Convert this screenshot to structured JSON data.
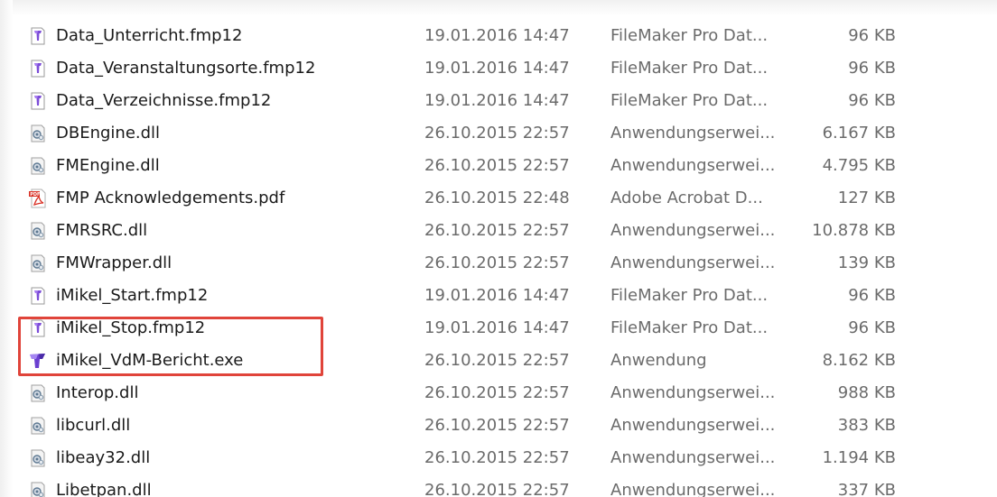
{
  "highlight_color": "#e0443a",
  "files": [
    {
      "icon": "filemaker-file-icon",
      "name": "Data_Unterricht.fmp12",
      "date": "19.01.2016 14:47",
      "type": "FileMaker Pro Dat...",
      "size": "96 KB"
    },
    {
      "icon": "filemaker-file-icon",
      "name": "Data_Veranstaltungsorte.fmp12",
      "date": "19.01.2016 14:47",
      "type": "FileMaker Pro Dat...",
      "size": "96 KB"
    },
    {
      "icon": "filemaker-file-icon",
      "name": "Data_Verzeichnisse.fmp12",
      "date": "19.01.2016 14:47",
      "type": "FileMaker Pro Dat...",
      "size": "96 KB"
    },
    {
      "icon": "dll-file-icon",
      "name": "DBEngine.dll",
      "date": "26.10.2015 22:57",
      "type": "Anwendungserwei...",
      "size": "6.167 KB"
    },
    {
      "icon": "dll-file-icon",
      "name": "FMEngine.dll",
      "date": "26.10.2015 22:57",
      "type": "Anwendungserwei...",
      "size": "4.795 KB"
    },
    {
      "icon": "pdf-file-icon",
      "name": "FMP Acknowledgements.pdf",
      "date": "26.10.2015 22:48",
      "type": "Adobe Acrobat D...",
      "size": "127 KB"
    },
    {
      "icon": "dll-file-icon",
      "name": "FMRSRC.dll",
      "date": "26.10.2015 22:57",
      "type": "Anwendungserwei...",
      "size": "10.878 KB"
    },
    {
      "icon": "dll-file-icon",
      "name": "FMWrapper.dll",
      "date": "26.10.2015 22:57",
      "type": "Anwendungserwei...",
      "size": "139 KB"
    },
    {
      "icon": "filemaker-file-icon",
      "name": "iMikel_Start.fmp12",
      "date": "19.01.2016 14:47",
      "type": "FileMaker Pro Dat...",
      "size": "96 KB"
    },
    {
      "icon": "filemaker-file-icon",
      "name": "iMikel_Stop.fmp12",
      "date": "19.01.2016 14:47",
      "type": "FileMaker Pro Dat...",
      "size": "96 KB"
    },
    {
      "icon": "filemaker-app-icon",
      "name": "iMikel_VdM-Bericht.exe",
      "date": "26.10.2015 22:57",
      "type": "Anwendung",
      "size": "8.162 KB"
    },
    {
      "icon": "dll-file-icon",
      "name": "Interop.dll",
      "date": "26.10.2015 22:57",
      "type": "Anwendungserwei...",
      "size": "988 KB"
    },
    {
      "icon": "dll-file-icon",
      "name": "libcurl.dll",
      "date": "26.10.2015 22:57",
      "type": "Anwendungserwei...",
      "size": "383 KB"
    },
    {
      "icon": "dll-file-icon",
      "name": "libeay32.dll",
      "date": "26.10.2015 22:57",
      "type": "Anwendungserwei...",
      "size": "1.194 KB"
    },
    {
      "icon": "dll-file-icon",
      "name": "Libetpan.dll",
      "date": "26.10.2015 22:57",
      "type": "Anwendungserwei...",
      "size": "337 KB"
    }
  ]
}
